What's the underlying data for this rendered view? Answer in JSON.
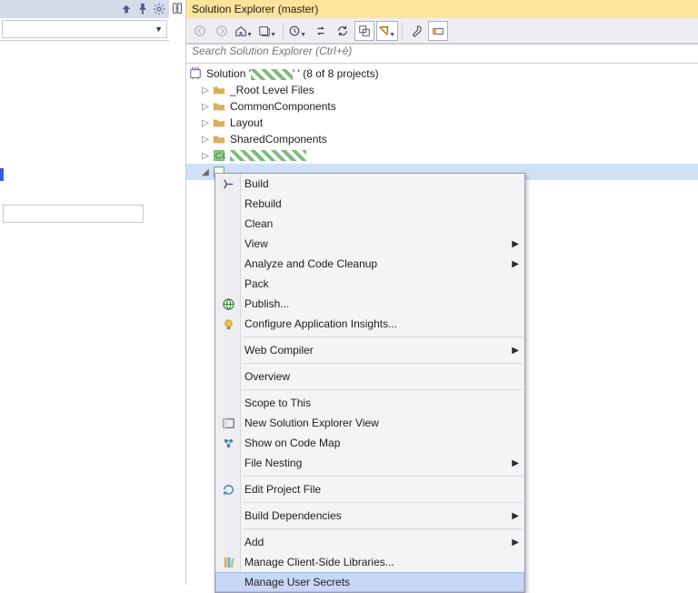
{
  "title": "Solution Explorer (master)",
  "search_placeholder": "Search Solution Explorer (Ctrl+è)",
  "solution_line": {
    "prefix": "Solution '",
    "suffix": "' (8 of 8 projects)"
  },
  "projects": [
    {
      "label": "_Root Level Files"
    },
    {
      "label": "CommonComponents"
    },
    {
      "label": "Layout"
    },
    {
      "label": "SharedComponents"
    }
  ],
  "menu": [
    {
      "label": "Build",
      "icon": "build"
    },
    {
      "label": "Rebuild"
    },
    {
      "label": "Clean"
    },
    {
      "label": "View",
      "sub": true
    },
    {
      "label": "Analyze and Code Cleanup",
      "sub": true
    },
    {
      "label": "Pack"
    },
    {
      "label": "Publish...",
      "icon": "globe"
    },
    {
      "label": "Configure Application Insights...",
      "icon": "bulb"
    },
    {
      "sep": true
    },
    {
      "label": "Web Compiler",
      "sub": true
    },
    {
      "sep": true
    },
    {
      "label": "Overview"
    },
    {
      "sep": true
    },
    {
      "label": "Scope to This"
    },
    {
      "label": "New Solution Explorer View",
      "icon": "panel"
    },
    {
      "label": "Show on Code Map",
      "icon": "map"
    },
    {
      "label": "File Nesting",
      "sub": true
    },
    {
      "sep": true
    },
    {
      "label": "Edit Project File",
      "icon": "edit"
    },
    {
      "sep": true
    },
    {
      "label": "Build Dependencies",
      "sub": true
    },
    {
      "sep": true
    },
    {
      "label": "Add",
      "sub": true
    },
    {
      "label": "Manage Client-Side Libraries...",
      "icon": "lib"
    },
    {
      "label": "Manage User Secrets",
      "highlight": true
    }
  ]
}
